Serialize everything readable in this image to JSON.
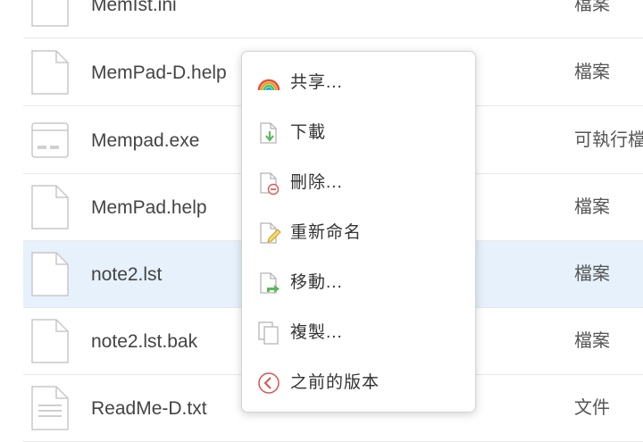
{
  "files": [
    {
      "name": "MemIst.ini",
      "type": "檔案",
      "icon": "file-icon",
      "selected": false
    },
    {
      "name": "MemPad-D.help",
      "type": "檔案",
      "icon": "file-icon",
      "selected": false
    },
    {
      "name": "Mempad.exe",
      "type": "可執行檔",
      "icon": "executable-icon",
      "selected": false
    },
    {
      "name": "MemPad.help",
      "type": "檔案",
      "icon": "file-icon",
      "selected": false
    },
    {
      "name": "note2.lst",
      "type": "檔案",
      "icon": "file-icon",
      "selected": true
    },
    {
      "name": "note2.lst.bak",
      "type": "檔案",
      "icon": "file-icon",
      "selected": false
    },
    {
      "name": "ReadMe-D.txt",
      "type": "文件",
      "icon": "text-file-icon",
      "selected": false
    }
  ],
  "context_menu": {
    "items": [
      {
        "label": "共享...",
        "icon": "share-icon"
      },
      {
        "label": "下載",
        "icon": "download-icon"
      },
      {
        "label": "刪除...",
        "icon": "delete-icon"
      },
      {
        "label": "重新命名",
        "icon": "rename-icon"
      },
      {
        "label": "移動...",
        "icon": "move-icon"
      },
      {
        "label": "複製...",
        "icon": "copy-icon"
      },
      {
        "label": "之前的版本",
        "icon": "previous-versions-icon"
      }
    ]
  },
  "colors": {
    "selected_row": "#e6f1fb",
    "download_arrow": "#5cb85c",
    "delete_badge": "#e05d5d",
    "move_arrow": "#5cb85c",
    "history_icon": "#d9534f"
  }
}
